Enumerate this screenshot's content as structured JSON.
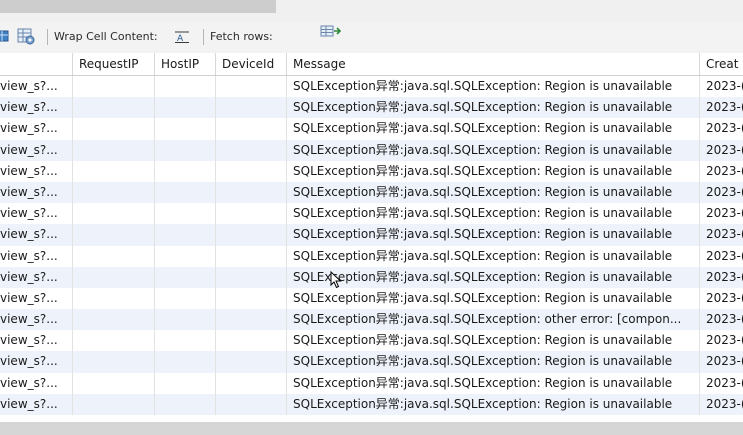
{
  "toolbar": {
    "wrap_label": "Wrap Cell Content:",
    "fetch_label": "Fetch rows:",
    "icons": [
      "table-icon",
      "grid-settings-icon",
      "wrap-text-icon",
      "fetch-rows-icon"
    ]
  },
  "columns": [
    "",
    "RequestIP",
    "HostIP",
    "DeviceId",
    "Message",
    "Creat"
  ],
  "rows": [
    {
      "c0": "view_s?...",
      "c1": "",
      "c2": "",
      "c3": "",
      "c4": "SQLException异常:java.sql.SQLException: Region is unavailable",
      "c5": "2023-("
    },
    {
      "c0": "view_s?...",
      "c1": "",
      "c2": "",
      "c3": "",
      "c4": "SQLException异常:java.sql.SQLException: Region is unavailable",
      "c5": "2023-("
    },
    {
      "c0": "view_s?...",
      "c1": "",
      "c2": "",
      "c3": "",
      "c4": "SQLException异常:java.sql.SQLException: Region is unavailable",
      "c5": "2023-("
    },
    {
      "c0": "view_s?...",
      "c1": "",
      "c2": "",
      "c3": "",
      "c4": "SQLException异常:java.sql.SQLException: Region is unavailable",
      "c5": "2023-("
    },
    {
      "c0": "view_s?...",
      "c1": "",
      "c2": "",
      "c3": "",
      "c4": "SQLException异常:java.sql.SQLException: Region is unavailable",
      "c5": "2023-("
    },
    {
      "c0": "view_s?...",
      "c1": "",
      "c2": "",
      "c3": "",
      "c4": "SQLException异常:java.sql.SQLException: Region is unavailable",
      "c5": "2023-("
    },
    {
      "c0": "view_s?...",
      "c1": "",
      "c2": "",
      "c3": "",
      "c4": "SQLException异常:java.sql.SQLException: Region is unavailable",
      "c5": "2023-("
    },
    {
      "c0": "view_s?...",
      "c1": "",
      "c2": "",
      "c3": "",
      "c4": "SQLException异常:java.sql.SQLException: Region is unavailable",
      "c5": "2023-("
    },
    {
      "c0": "view_s?...",
      "c1": "",
      "c2": "",
      "c3": "",
      "c4": "SQLException异常:java.sql.SQLException: Region is unavailable",
      "c5": "2023-("
    },
    {
      "c0": "view_s?...",
      "c1": "",
      "c2": "",
      "c3": "",
      "c4": "SQLException异常:java.sql.SQLException: Region is unavailable",
      "c5": "2023-("
    },
    {
      "c0": "view_s?...",
      "c1": "",
      "c2": "",
      "c3": "",
      "c4": "SQLException异常:java.sql.SQLException: Region is unavailable",
      "c5": "2023-("
    },
    {
      "c0": "view_s?...",
      "c1": "",
      "c2": "",
      "c3": "",
      "c4": "SQLException异常:java.sql.SQLException: other error: [compon...",
      "c5": "2023-("
    },
    {
      "c0": "view_s?...",
      "c1": "",
      "c2": "",
      "c3": "",
      "c4": "SQLException异常:java.sql.SQLException: Region is unavailable",
      "c5": "2023-("
    },
    {
      "c0": "view_s?...",
      "c1": "",
      "c2": "",
      "c3": "",
      "c4": "SQLException异常:java.sql.SQLException: Region is unavailable",
      "c5": "2023-("
    },
    {
      "c0": "view_s?...",
      "c1": "",
      "c2": "",
      "c3": "",
      "c4": "SQLException异常:java.sql.SQLException: Region is unavailable",
      "c5": "2023-("
    },
    {
      "c0": "view_s?...",
      "c1": "",
      "c2": "",
      "c3": "",
      "c4": "SQLException异常:java.sql.SQLException: Region is unavailable",
      "c5": "2023-("
    }
  ]
}
